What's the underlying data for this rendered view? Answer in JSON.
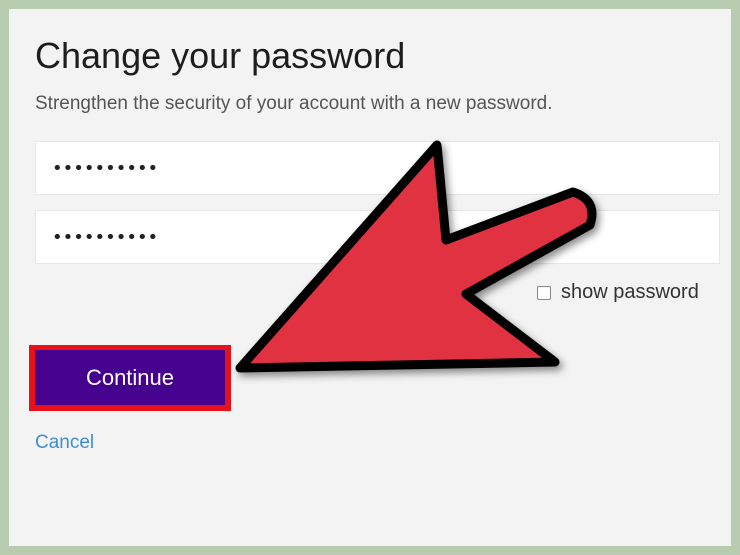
{
  "title": "Change your password",
  "subtitle": "Strengthen the security of your account with a new password.",
  "fields": [
    {
      "value": "••••••••••"
    },
    {
      "value": "••••••••••"
    }
  ],
  "show_password": {
    "label": "show password",
    "checked": false
  },
  "continue_button": {
    "label": "Continue"
  },
  "cancel_link": {
    "label": "Cancel"
  },
  "colors": {
    "button": "#45028e",
    "highlight": "#e8101a",
    "link": "#3f8fd6",
    "arrow": "#e0303f",
    "frame": "#b8ccb0"
  },
  "annotation": {
    "icon": "arrow-pointer-icon"
  }
}
